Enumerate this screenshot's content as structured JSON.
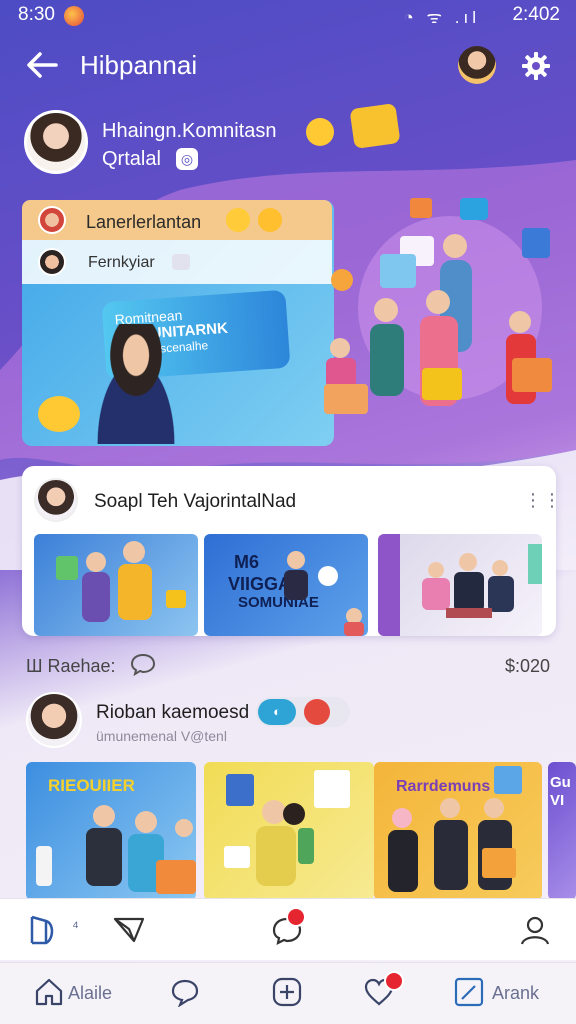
{
  "status_bar": {
    "time": "8:30",
    "icons": "◔ ᯤ .ıl",
    "clock": "2:402"
  },
  "header": {
    "title": "Hibpannai"
  },
  "profile": {
    "name": "Hhaingn.Komnitasn",
    "subtitle": "Qrtalal",
    "badge": "◎"
  },
  "hero": {
    "row1": "Lanerlerlantan",
    "row2": "Fernkyiar",
    "banner_line1": "Romitnean",
    "banner_line2": "KOMUNITARNK",
    "banner_line3": "Oreml Ascenalhe"
  },
  "post_card": {
    "title": "Soapl Teh VajorintalNad",
    "more": "⋮⋮",
    "thumb2_line1": "M6",
    "thumb2_line2": "VIIGGAI",
    "thumb2_line3": "SOMUNIAE"
  },
  "reactions": {
    "left_label": "Ш Raehae:",
    "right_label": "$:020"
  },
  "user": {
    "name": "Rioban kaemoesd",
    "subtitle": "ümunemenal V@tenl",
    "pill_label": "◐"
  },
  "gallery": {
    "item1": "RIEOUIIER",
    "item3": "Rarrdemuns",
    "item4_line1": "Gu",
    "item4_line2": "VI"
  },
  "action_bar": {
    "first_label": "⁴"
  },
  "bottom_nav": {
    "home_label": "Alaile",
    "last_label": "Arank"
  },
  "colors": {
    "primary": "#5a4fc8",
    "accent": "#2ea4d6",
    "badge": "#e5252f"
  }
}
